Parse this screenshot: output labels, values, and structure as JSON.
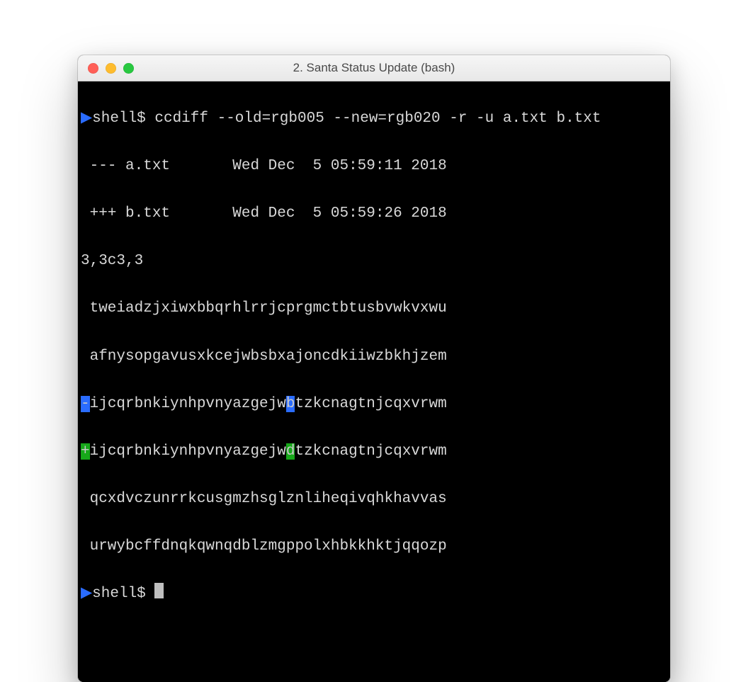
{
  "window": {
    "title": "2. Santa Status Update (bash)"
  },
  "prompt": {
    "caret": "▶",
    "text": "shell$ "
  },
  "command": "ccdiff --old=rgb005 --new=rgb020 -r -u a.txt b.txt",
  "diff": {
    "header_old": "--- a.txt       Wed Dec  5 05:59:11 2018",
    "header_new": "+++ b.txt       Wed Dec  5 05:59:26 2018",
    "range": "3,3c3,3",
    "ctx1": " tweiadzjxiwxbbqrhlrrjcprgmctbtusbvwkvxwu",
    "ctx2": " afnysopgavusxkcejwbsbxajoncdkiiwzbkhjzem",
    "minus": {
      "mark": "-",
      "pre": "ijcqrbnkiynhpvnyazgejw",
      "char": "b",
      "post": "tzkcnagtnjcqxvrwm"
    },
    "plus": {
      "mark": "+",
      "pre": "ijcqrbnkiynhpvnyazgejw",
      "char": "d",
      "post": "tzkcnagtnjcqxvrwm"
    },
    "ctx3": " qcxdvczunrrkcusgmzhsglznliheqivqhkhavvas",
    "ctx4": " urwybcffdnqkqwnqdblzmgppolxhbkkhktjqqozp"
  }
}
